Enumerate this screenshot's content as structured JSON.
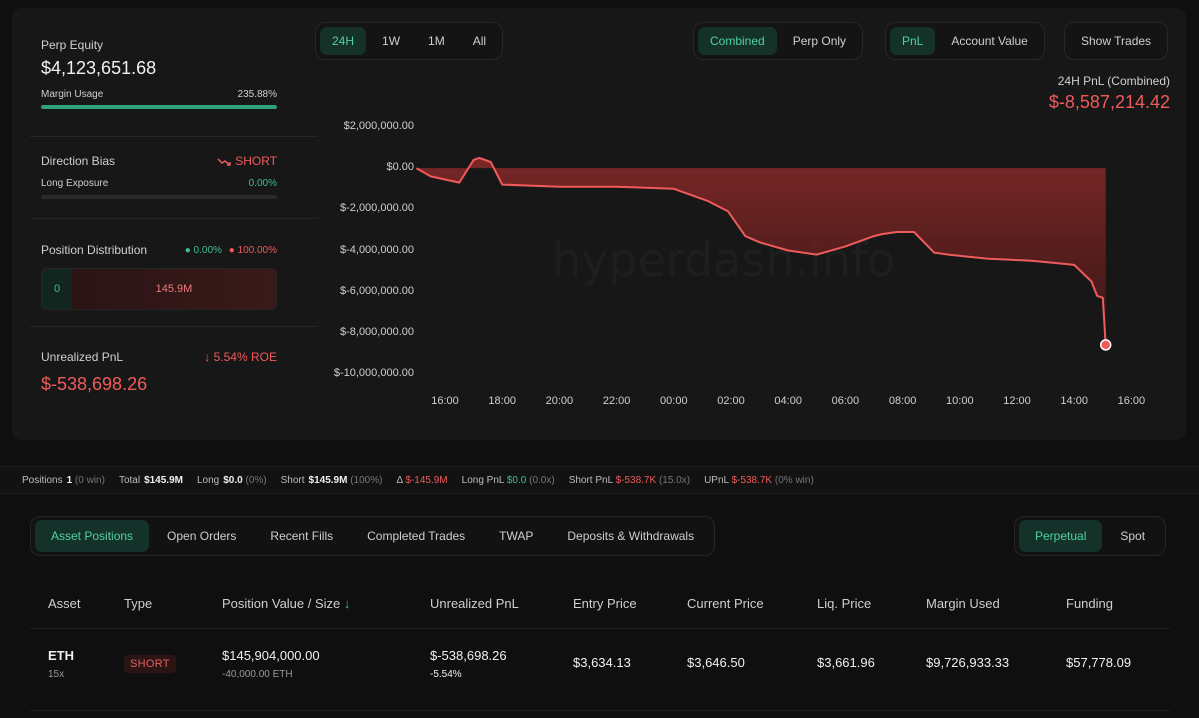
{
  "summary": {
    "perp_equity_label": "Perp Equity",
    "perp_equity_value": "$4,123,651.68",
    "margin_usage_label": "Margin Usage",
    "margin_usage_value": "235.88%",
    "margin_usage_fraction": 1.0,
    "direction_bias_label": "Direction Bias",
    "direction_bias_value": "SHORT",
    "long_exposure_label": "Long Exposure",
    "long_exposure_value": "0.00%",
    "long_exposure_fraction": 0.0,
    "position_distribution_label": "Position Distribution",
    "dist_long_pct": "0.00%",
    "dist_short_pct": "100.00%",
    "dist_long_value": "0",
    "dist_short_value": "145.9M",
    "unrealized_pnl_label": "Unrealized PnL",
    "roe_value": "5.54% ROE",
    "unrealized_pnl_value": "$-538,698.26"
  },
  "chart_controls": {
    "timeframes": [
      "24H",
      "1W",
      "1M",
      "All"
    ],
    "active_timeframe": "24H",
    "modes": [
      "Combined",
      "Perp Only"
    ],
    "active_mode": "Combined",
    "metrics": [
      "PnL",
      "Account Value"
    ],
    "active_metric": "PnL",
    "show_trades_label": "Show Trades"
  },
  "pnl_header": {
    "label": "24H PnL (Combined)",
    "value": "$-8,587,214.42"
  },
  "watermark": "hyperdash.info",
  "chart_data": {
    "type": "area",
    "title": "",
    "xlabel": "",
    "ylabel": "",
    "x_ticks": [
      "16:00",
      "18:00",
      "20:00",
      "22:00",
      "00:00",
      "02:00",
      "04:00",
      "06:00",
      "08:00",
      "10:00",
      "12:00",
      "14:00",
      "16:00"
    ],
    "y_ticks": [
      "$2,000,000.00",
      "$0.00",
      "$-2,000,000.00",
      "$-4,000,000.00",
      "$-6,000,000.00",
      "$-8,000,000.00",
      "$-10,000,000.00"
    ],
    "y_tick_values": [
      2000000,
      0,
      -2000000,
      -4000000,
      -6000000,
      -8000000,
      -10000000
    ],
    "ylim": [
      -10000000,
      2000000
    ],
    "x_hours": [
      -1,
      -0.5,
      0.5,
      1.0,
      1.2,
      1.6,
      2,
      4,
      6,
      8,
      9.2,
      9.9,
      10.5,
      11,
      12,
      13,
      14,
      15,
      15.3,
      15.8,
      16.4,
      17.1,
      17.6,
      18.3,
      19,
      19.8,
      20.5,
      21.3,
      22,
      22.6,
      22.8,
      23,
      23.1
    ],
    "values": [
      0,
      -400000,
      -700000,
      400000,
      500000,
      300000,
      -800000,
      -900000,
      -900000,
      -1000000,
      -1600000,
      -2100000,
      -3300000,
      -3600000,
      -4000000,
      -4200000,
      -3800000,
      -3300000,
      -3200000,
      -3100000,
      -3100000,
      -4100000,
      -4200000,
      -4300000,
      -4400000,
      -4450000,
      -4500000,
      -4600000,
      -4700000,
      -5500000,
      -6200000,
      -6300000,
      -8587214
    ],
    "series": [
      {
        "name": "",
        "color": "#ef5b5b"
      }
    ],
    "grid": false,
    "legend": "none"
  },
  "stats_bar": {
    "positions_label": "Positions",
    "positions_value": "1",
    "positions_note": "(0 win)",
    "total_label": "Total",
    "total_value": "$145.9M",
    "long_label": "Long",
    "long_value": "$0.0",
    "long_note": "(0%)",
    "short_label": "Short",
    "short_value": "$145.9M",
    "short_note": "(100%)",
    "delta_label": "Δ",
    "delta_value": "$-145.9M",
    "long_pnl_label": "Long PnL",
    "long_pnl_value": "$0.0",
    "long_pnl_note": "(0.0x)",
    "short_pnl_label": "Short PnL",
    "short_pnl_value": "$-538.7K",
    "short_pnl_note": "(15.0x)",
    "upnl_label": "UPnL",
    "upnl_value": "$-538.7K",
    "upnl_note": "(0% win)"
  },
  "tabs": {
    "items": [
      "Asset Positions",
      "Open Orders",
      "Recent Fills",
      "Completed Trades",
      "TWAP",
      "Deposits & Withdrawals"
    ],
    "active": "Asset Positions"
  },
  "market_tabs": {
    "items": [
      "Perpetual",
      "Spot"
    ],
    "active": "Perpetual"
  },
  "table": {
    "headers": [
      "Asset",
      "Type",
      "Position Value / Size",
      "Unrealized PnL",
      "Entry Price",
      "Current Price",
      "Liq. Price",
      "Margin Used",
      "Funding"
    ],
    "rows": [
      {
        "asset": "ETH",
        "leverage": "15x",
        "type": "SHORT",
        "position_value": "$145,904,000.00",
        "position_size": "-40,000.00 ETH",
        "unrealized_pnl": "$-538,698.26",
        "unrealized_pnl_pct": "-5.54%",
        "entry_price": "$3,634.13",
        "current_price": "$3,646.50",
        "liq_price": "$3,661.96",
        "margin_used": "$9,726,933.33",
        "funding": "$57,778.09"
      }
    ]
  },
  "colors": {
    "accent_green": "#3fbf8f",
    "accent_red": "#ef5b5b",
    "background": "#0f0f0f",
    "panel": "#171717"
  }
}
